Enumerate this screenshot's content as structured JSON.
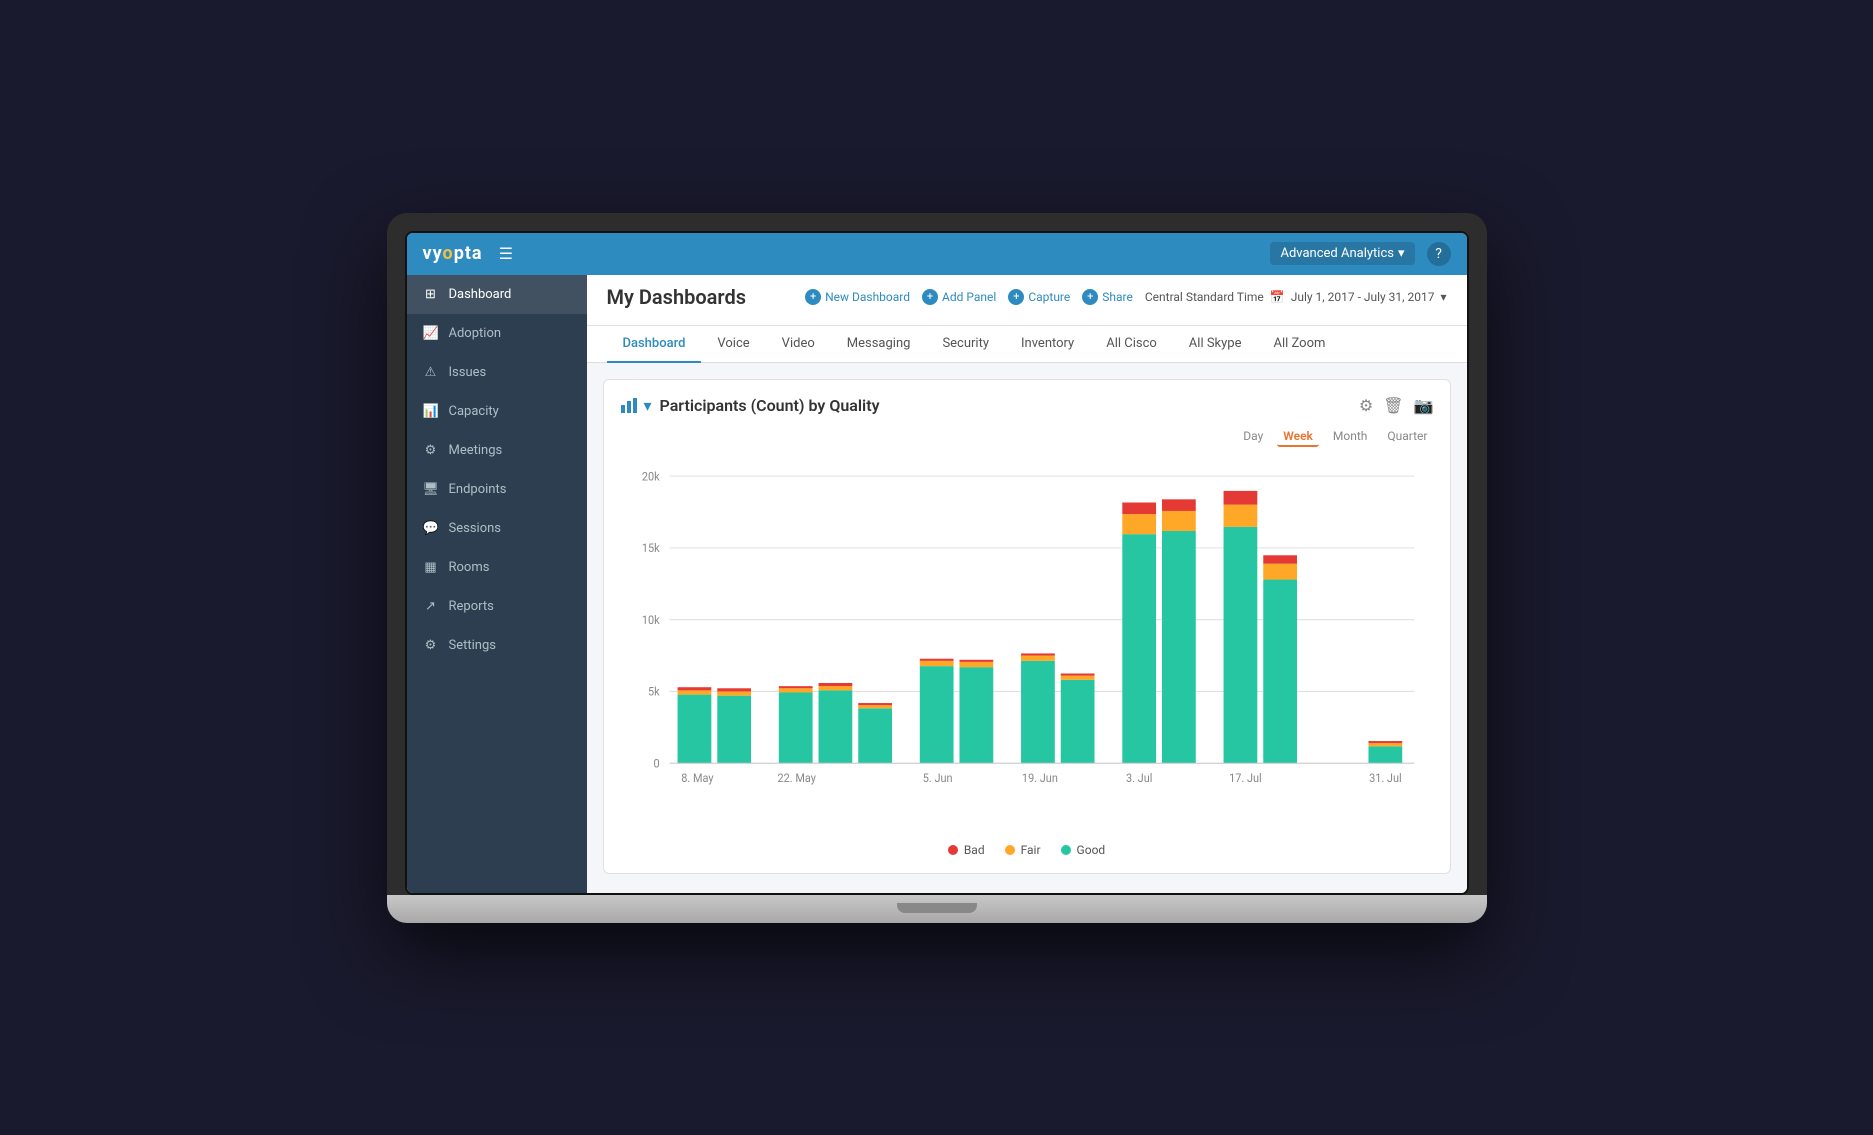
{
  "topbar": {
    "logo": "vy",
    "logo_highlight": "o",
    "logo_rest": "pta",
    "menu_icon": "☰",
    "advanced_analytics": "Advanced Analytics",
    "help": "?",
    "timezone": "Central Standard Time",
    "date_range": "July 1, 2017 - July 31, 2017"
  },
  "sidebar": {
    "items": [
      {
        "id": "dashboard",
        "label": "Dashboard",
        "icon": "⊞",
        "active": true
      },
      {
        "id": "adoption",
        "label": "Adoption",
        "icon": "📈"
      },
      {
        "id": "issues",
        "label": "Issues",
        "icon": "⚠"
      },
      {
        "id": "capacity",
        "label": "Capacity",
        "icon": "📊"
      },
      {
        "id": "meetings",
        "label": "Meetings",
        "icon": "⚙"
      },
      {
        "id": "endpoints",
        "label": "Endpoints",
        "icon": "🖥"
      },
      {
        "id": "sessions",
        "label": "Sessions",
        "icon": "💬"
      },
      {
        "id": "rooms",
        "label": "Rooms",
        "icon": "▦"
      },
      {
        "id": "reports",
        "label": "Reports",
        "icon": "↗"
      },
      {
        "id": "settings",
        "label": "Settings",
        "icon": "⚙"
      }
    ]
  },
  "dashboard": {
    "title": "My Dashboards",
    "actions": {
      "new_dashboard": "New Dashboard",
      "add_panel": "Add Panel",
      "capture": "Capture",
      "share": "Share"
    },
    "tabs": [
      {
        "id": "dashboard",
        "label": "Dashboard",
        "active": true
      },
      {
        "id": "voice",
        "label": "Voice"
      },
      {
        "id": "video",
        "label": "Video"
      },
      {
        "id": "messaging",
        "label": "Messaging"
      },
      {
        "id": "security",
        "label": "Security"
      },
      {
        "id": "inventory",
        "label": "Inventory"
      },
      {
        "id": "all_cisco",
        "label": "All Cisco"
      },
      {
        "id": "all_skype",
        "label": "All Skype"
      },
      {
        "id": "all_zoom",
        "label": "All Zoom"
      }
    ]
  },
  "chart": {
    "title": "Participants (Count) by Quality",
    "time_buttons": [
      {
        "id": "day",
        "label": "Day"
      },
      {
        "id": "week",
        "label": "Week",
        "active": true
      },
      {
        "id": "month",
        "label": "Month"
      },
      {
        "id": "quarter",
        "label": "Quarter"
      }
    ],
    "y_labels": [
      "20k",
      "15k",
      "10k",
      "5k",
      "0"
    ],
    "x_labels": [
      "8. May",
      "22. May",
      "5. Jun",
      "19. Jun",
      "3. Jul",
      "17. Jul",
      "31. Jul"
    ],
    "legend": [
      {
        "label": "Bad",
        "color": "#e53935"
      },
      {
        "label": "Fair",
        "color": "#ffa726"
      },
      {
        "label": "Good",
        "color": "#26c6a2"
      }
    ],
    "bars": [
      {
        "x_label": "8. May",
        "good": 4800,
        "fair": 300,
        "bad": 100
      },
      {
        "x_label": "",
        "good": 4700,
        "fair": 250,
        "bad": 80
      },
      {
        "x_label": "22. May",
        "good": 4900,
        "fair": 200,
        "bad": 60
      },
      {
        "x_label": "",
        "good": 5100,
        "fair": 280,
        "bad": 90
      },
      {
        "x_label": "",
        "good": 3800,
        "fair": 200,
        "bad": 50
      },
      {
        "x_label": "5. Jun",
        "good": 6800,
        "fair": 400,
        "bad": 120
      },
      {
        "x_label": "",
        "good": 6700,
        "fair": 380,
        "bad": 110
      },
      {
        "x_label": "19. Jun",
        "good": 7200,
        "fair": 450,
        "bad": 130
      },
      {
        "x_label": "",
        "good": 5800,
        "fair": 300,
        "bad": 90
      },
      {
        "x_label": "3. Jul",
        "good": 16000,
        "fair": 1500,
        "bad": 800
      },
      {
        "x_label": "",
        "good": 16200,
        "fair": 1400,
        "bad": 750
      },
      {
        "x_label": "17. Jul",
        "good": 16500,
        "fair": 1600,
        "bad": 900
      },
      {
        "x_label": "",
        "good": 12800,
        "fair": 1200,
        "bad": 600
      },
      {
        "x_label": "31. Jul",
        "good": 1200,
        "fair": 200,
        "bad": 80
      }
    ],
    "max_value": 20000
  }
}
